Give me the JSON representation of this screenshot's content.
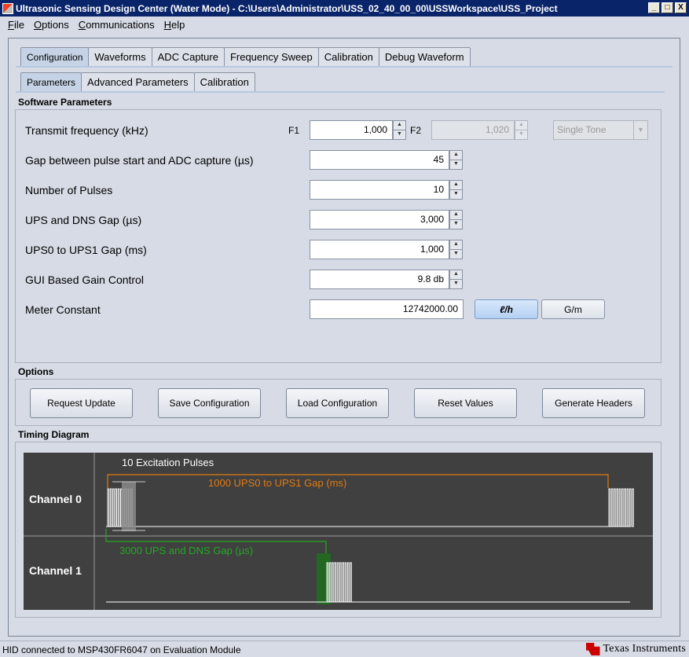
{
  "window": {
    "title": "Ultrasonic Sensing Design Center (Water Mode) - C:\\Users\\Administrator\\USS_02_40_00_00\\USSWorkspace\\USS_Project",
    "controls": [
      "_",
      "□",
      "X"
    ]
  },
  "menu": [
    "File",
    "Options",
    "Communications",
    "Help"
  ],
  "main_tabs": [
    "Configuration",
    "Waveforms",
    "ADC Capture",
    "Frequency Sweep",
    "Calibration",
    "Debug Waveform"
  ],
  "sub_tabs": [
    "Parameters",
    "Advanced Parameters",
    "Calibration"
  ],
  "software_parameters": {
    "title": "Software Parameters",
    "rows": [
      {
        "label": "Transmit frequency (kHz)"
      },
      {
        "label": "Gap between pulse start and ADC capture (µs)",
        "value": "45"
      },
      {
        "label": "Number of Pulses",
        "value": "10"
      },
      {
        "label": "UPS and DNS Gap (µs)",
        "value": "3,000"
      },
      {
        "label": "UPS0 to UPS1 Gap (ms)",
        "value": "1,000"
      },
      {
        "label": "GUI Based Gain Control",
        "value": "9.8 db"
      },
      {
        "label": "Meter Constant",
        "value": "12742000.00"
      }
    ],
    "f1_label": "F1",
    "f1_value": "1,000",
    "f2_label": "F2",
    "f2_value": "1,020",
    "tone_select": "Single Tone",
    "unit_lh": "ℓ/h",
    "unit_gm": "G/m"
  },
  "options": {
    "title": "Options",
    "buttons": [
      "Request Update",
      "Save Configuration",
      "Load Configuration",
      "Reset Values",
      "Generate Headers"
    ]
  },
  "timing": {
    "title": "Timing Diagram",
    "channel0": "Channel 0",
    "channel1": "Channel 1",
    "excitation_label": "10 Excitation Pulses",
    "ups_gap_label": "1000 UPS0 to UPS1 Gap (ms)",
    "dns_gap_label": "3000 UPS and DNS Gap (µs)",
    "colors": {
      "background": "#404040",
      "ups_gap": "#e07a10",
      "dns_gap": "#22aa22",
      "pulses": "#ffffff"
    }
  },
  "status": {
    "text": "HID connected to MSP430FR6047 on Evaluation Module",
    "logo_text": "Texas Instruments"
  }
}
